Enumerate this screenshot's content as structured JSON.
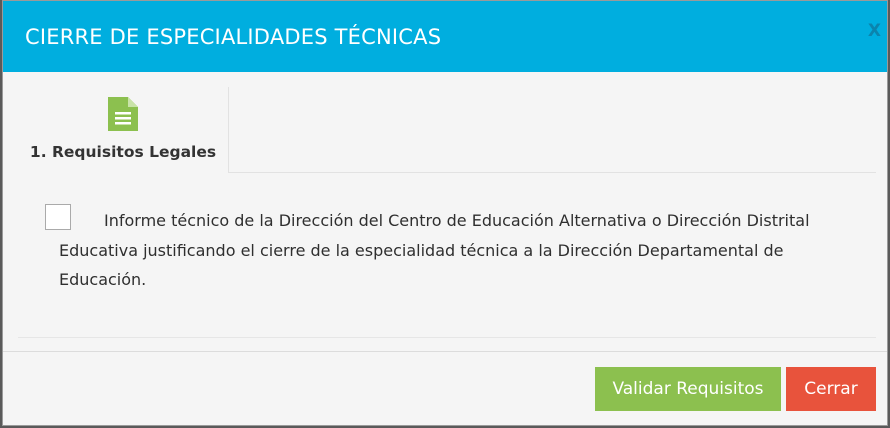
{
  "modal": {
    "title": "CIERRE DE ESPECIALIDADES TÉCNICAS",
    "close_label": "X"
  },
  "tabs": [
    {
      "label": "1. Requisitos Legales",
      "icon": "document-icon",
      "icon_color": "#8cc04f"
    }
  ],
  "requirements": [
    {
      "checked": false,
      "text": "Informe técnico de la Dirección del Centro de Educación Alternativa o Dirección Distrital Educativa justificando el cierre de la especialidad técnica a la Dirección Departamental de Educación."
    }
  ],
  "footer": {
    "validate_label": "Validar Requisitos",
    "close_label": "Cerrar"
  },
  "colors": {
    "header": "#00aedf",
    "validate": "#8cc04f",
    "close": "#e8533c"
  }
}
